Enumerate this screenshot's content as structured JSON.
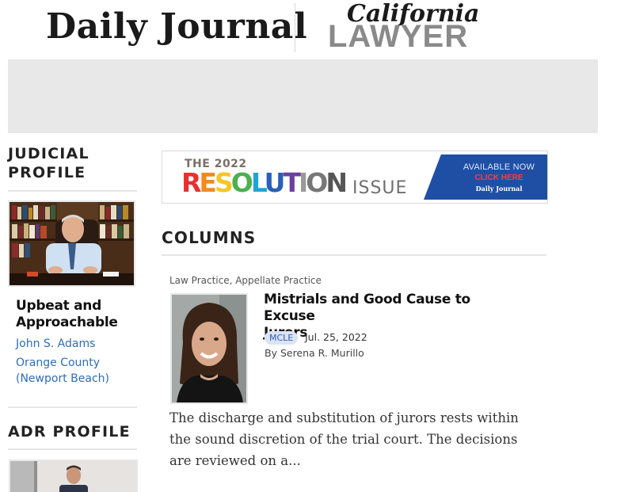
{
  "header": {
    "daily_journal_logo": "Daily Journal",
    "california_lawyer_logo_top": "California",
    "california_lawyer_logo_bottom": "LAWYER"
  },
  "judicial_profile": {
    "title_line1": "JUDICIAL",
    "title_line2": "PROFILE",
    "headline_line1": "Upbeat and",
    "headline_line2": "Approachable",
    "name": "John S. Adams",
    "location_line1": "Orange County",
    "location_line2": "(Newport Beach)"
  },
  "adr_profile": {
    "title": "ADR PROFILE"
  },
  "resolution_banner": {
    "year_text": "THE 2022",
    "word": "RESOLUTION",
    "issue": "ISSUE",
    "available": "AVAILABLE NOW",
    "click": "CLICK HERE",
    "brand": "Daily Journal",
    "letter_colors": [
      "#e8302f",
      "#f28a1e",
      "#f6c623",
      "#4caf50",
      "#1fa4d6",
      "#2a5fb5",
      "#6b3fa0",
      "#999999",
      "#777777",
      "#555555"
    ]
  },
  "columns": {
    "title": "COLUMNS",
    "article": {
      "category": "Law Practice, Appellate Practice",
      "title_line1": "Mistrials and Good Cause to Excuse",
      "title_line2": "Jurors",
      "badge": "MCLE",
      "date": "Jul. 25, 2022",
      "author": "By Serena R. Murillo",
      "excerpt_line1": "The discharge and substitution of jurors rests within",
      "excerpt_line2": "the sound discretion of the trial court. The decisions",
      "excerpt_line3": "are reviewed on a..."
    }
  },
  "colors": {
    "link": "#2f6db5",
    "banner_blue": "#1f4fa5",
    "ad_gray": "#e8e8e8"
  }
}
